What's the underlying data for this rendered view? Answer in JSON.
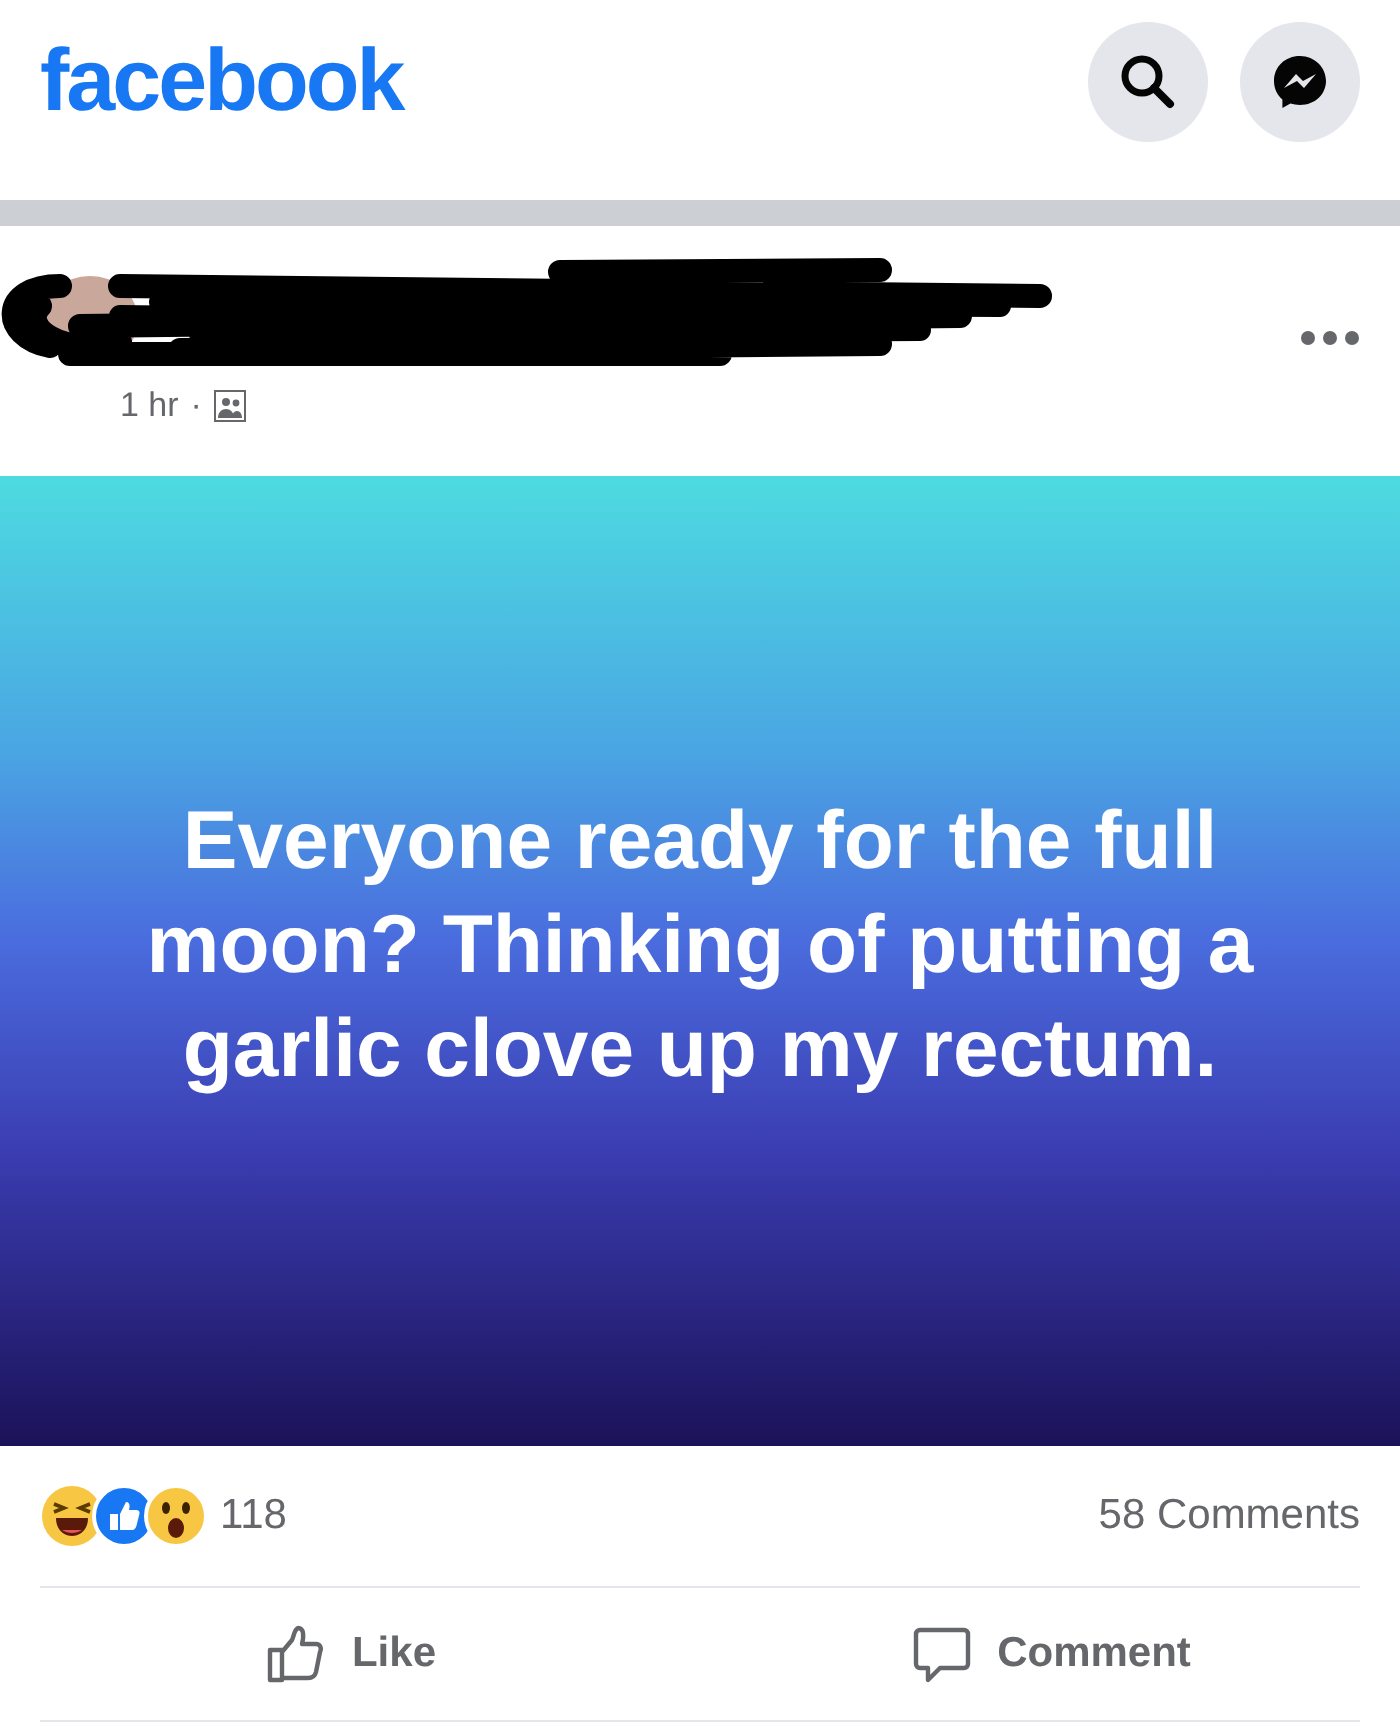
{
  "header": {
    "logo": "facebook"
  },
  "post": {
    "time": "1 hr",
    "separator": "·",
    "redacted": true,
    "text": "Everyone ready for the full moon? Thinking of putting a garlic clove up my rectum.",
    "reaction_count": "118",
    "comments_count": "58 Comments"
  },
  "actions": [
    {
      "kind": "like",
      "label": "Like"
    },
    {
      "kind": "comment",
      "label": "Comment"
    }
  ]
}
